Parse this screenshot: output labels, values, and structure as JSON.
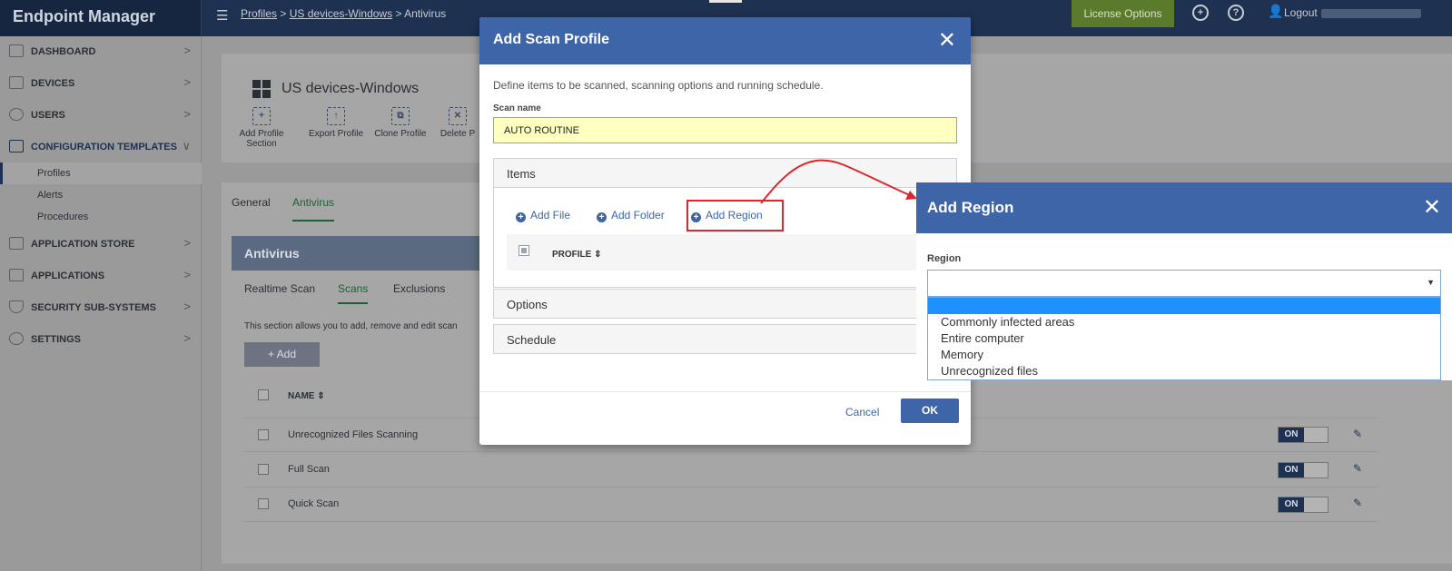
{
  "topbar": {
    "brand": "Endpoint Manager",
    "breadcrumb": {
      "profiles": "Profiles",
      "sep1": ">",
      "group": "US devices-Windows",
      "sep2": ">",
      "current": "Antivirus"
    },
    "license_button": "License Options",
    "logout": "Logout"
  },
  "sidebar": {
    "items": [
      {
        "label": "DASHBOARD",
        "chevron": ">"
      },
      {
        "label": "DEVICES",
        "chevron": ">"
      },
      {
        "label": "USERS",
        "chevron": ">"
      },
      {
        "label": "CONFIGURATION TEMPLATES",
        "chevron": "∨"
      },
      {
        "label": "APPLICATION STORE",
        "chevron": ">"
      },
      {
        "label": "APPLICATIONS",
        "chevron": ">"
      },
      {
        "label": "SECURITY SUB-SYSTEMS",
        "chevron": ">"
      },
      {
        "label": "SETTINGS",
        "chevron": ">"
      }
    ],
    "sub_items": [
      "Profiles",
      "Alerts",
      "Procedures"
    ]
  },
  "device_panel": {
    "title": "US devices-Windows",
    "tools": [
      {
        "label": "Add Profile Section"
      },
      {
        "label": "Export Profile"
      },
      {
        "label": "Clone Profile"
      },
      {
        "label": "Delete P"
      }
    ]
  },
  "content": {
    "tabs": [
      "General",
      "Antivirus"
    ],
    "section_header": "Antivirus",
    "sub_tabs": [
      "Realtime Scan",
      "Scans",
      "Exclusions"
    ],
    "description": "This section allows you to add, remove and edit scan",
    "add_button": "+ Add",
    "name_column": "NAME ⇕",
    "rows": [
      {
        "name": "Unrecognized Files Scanning",
        "toggle": "ON"
      },
      {
        "name": "Full Scan",
        "toggle": "ON"
      },
      {
        "name": "Quick Scan",
        "toggle": "ON"
      }
    ]
  },
  "modal": {
    "title": "Add Scan Profile",
    "close": "✕",
    "description": "Define items to be scanned, scanning options and running schedule.",
    "scan_name_label": "Scan name",
    "scan_name_value": "AUTO ROUTINE",
    "items_header": "Items",
    "add_file": "Add File",
    "add_folder": "Add Folder",
    "add_region": "Add Region",
    "profile_column": "PROFILE ⇕",
    "options_header": "Options",
    "schedule_header": "Schedule",
    "cancel": "Cancel",
    "ok": "OK"
  },
  "region_panel": {
    "title": "Add Region",
    "close": "✕",
    "label": "Region",
    "options": [
      "",
      "Commonly infected areas",
      "Entire computer",
      "Memory",
      "Unrecognized files"
    ]
  },
  "colors": {
    "accent": "#3e65a8",
    "topbar": "#1e3150",
    "highlight": "#e0252d",
    "input_bg": "#ffffc0"
  }
}
